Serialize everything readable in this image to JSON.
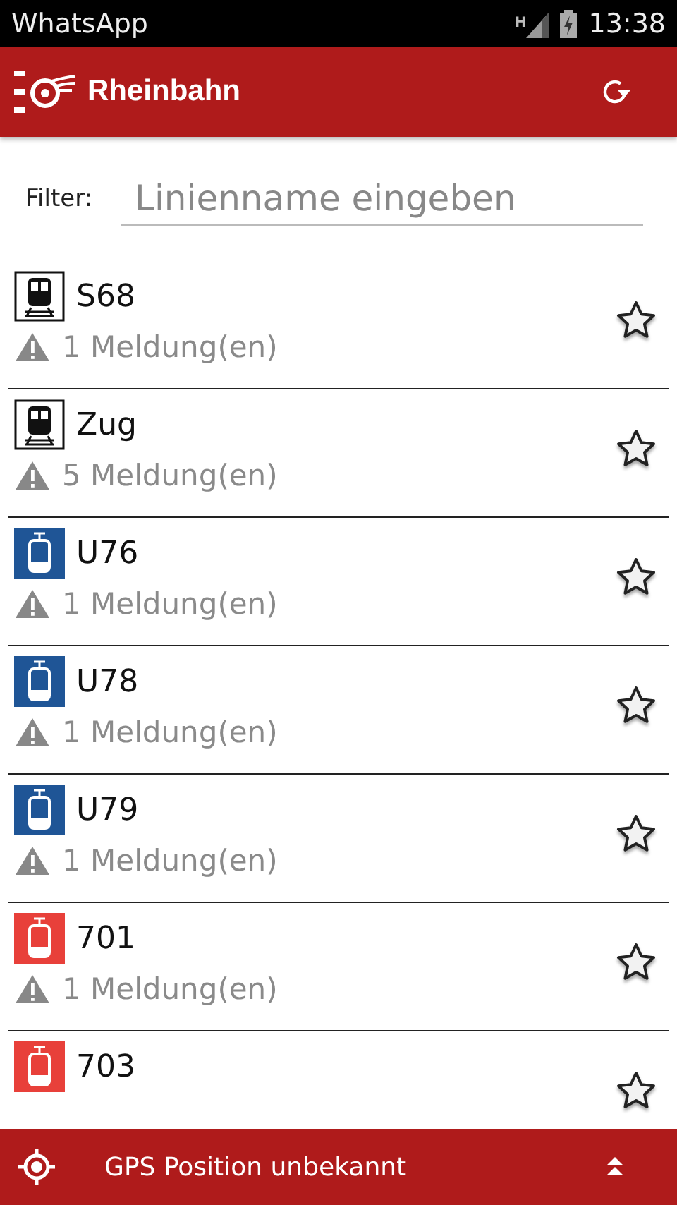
{
  "status_bar": {
    "app": "WhatsApp",
    "network": "H",
    "time": "13:38"
  },
  "header": {
    "title": "Rheinbahn"
  },
  "filter": {
    "label": "Filter:",
    "placeholder": "Linienname eingeben"
  },
  "lines": [
    {
      "name": "S68",
      "kind": "train",
      "message": "1 Meldung(en)",
      "favorite": false
    },
    {
      "name": "Zug",
      "kind": "train",
      "message": "5 Meldung(en)",
      "favorite": false
    },
    {
      "name": "U76",
      "kind": "tram",
      "color": "#1f5596",
      "message": "1 Meldung(en)",
      "favorite": false
    },
    {
      "name": "U78",
      "kind": "tram",
      "color": "#1f5596",
      "message": "1 Meldung(en)",
      "favorite": false
    },
    {
      "name": "U79",
      "kind": "tram",
      "color": "#1f5596",
      "message": "1 Meldung(en)",
      "favorite": false
    },
    {
      "name": "701",
      "kind": "tram",
      "color": "#e8403a",
      "message": "1 Meldung(en)",
      "favorite": false
    },
    {
      "name": "703",
      "kind": "tram",
      "color": "#e8403a",
      "favorite": false
    }
  ],
  "footer": {
    "text": "GPS Position unbekannt"
  }
}
